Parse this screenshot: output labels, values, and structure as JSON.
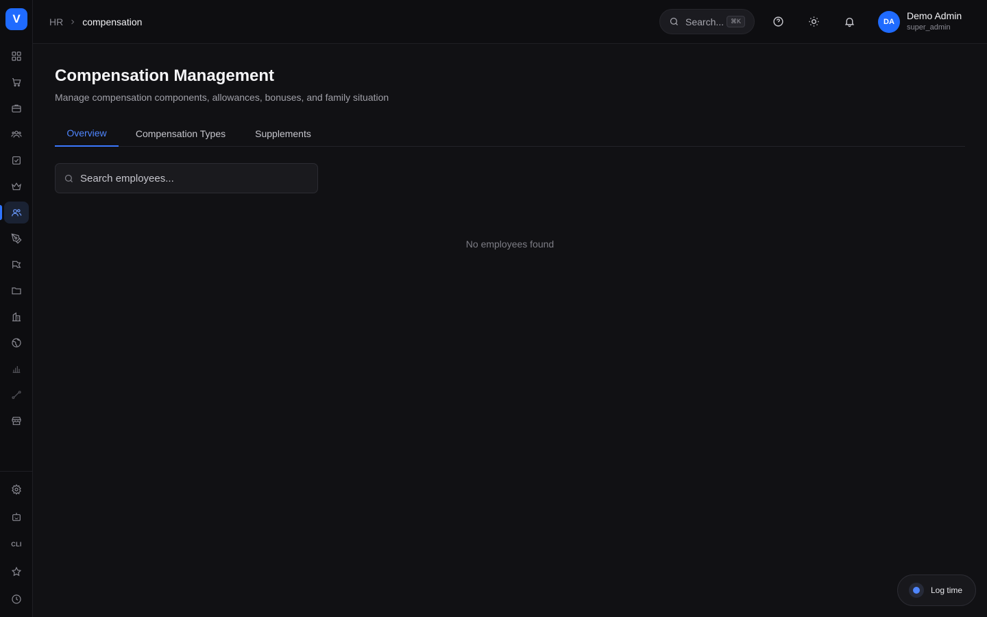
{
  "app": {
    "logo_letter": "V"
  },
  "breadcrumb": {
    "root": "HR",
    "current": "compensation"
  },
  "topbar": {
    "search_label": "Search...",
    "search_shortcut": "⌘K",
    "user": {
      "initials": "DA",
      "name": "Demo Admin",
      "role": "super_admin"
    }
  },
  "sidebar": {
    "items": [
      {
        "icon": "dashboard-grid-icon"
      },
      {
        "icon": "shopping-cart-icon"
      },
      {
        "icon": "briefcase-icon"
      },
      {
        "icon": "team-icon"
      },
      {
        "icon": "checkbox-icon"
      },
      {
        "icon": "crown-icon"
      },
      {
        "icon": "users-icon",
        "active": true
      },
      {
        "icon": "pen-tool-icon"
      },
      {
        "icon": "megaphone-icon"
      },
      {
        "icon": "folder-icon"
      },
      {
        "icon": "building-icon"
      },
      {
        "icon": "globe-icon"
      },
      {
        "icon": "bar-chart-icon"
      },
      {
        "icon": "route-icon"
      },
      {
        "icon": "store-icon"
      }
    ],
    "bottom_items": [
      {
        "icon": "settings-gear-icon"
      },
      {
        "icon": "robot-icon"
      },
      {
        "icon": "cli-icon",
        "label": "CLI"
      },
      {
        "icon": "star-icon"
      },
      {
        "icon": "clock-icon"
      }
    ]
  },
  "page": {
    "title": "Compensation Management",
    "subtitle": "Manage compensation components, allowances, bonuses, and family situation"
  },
  "tabs": [
    {
      "label": "Overview",
      "active": true
    },
    {
      "label": "Compensation Types"
    },
    {
      "label": "Supplements"
    }
  ],
  "employee_search": {
    "placeholder": "Search employees...",
    "value": ""
  },
  "empty_state": "No employees found",
  "log_time": {
    "label": "Log time"
  },
  "colors": {
    "accent": "#1f6bff",
    "background": "#111114",
    "active_tab": "#4f86ff"
  }
}
